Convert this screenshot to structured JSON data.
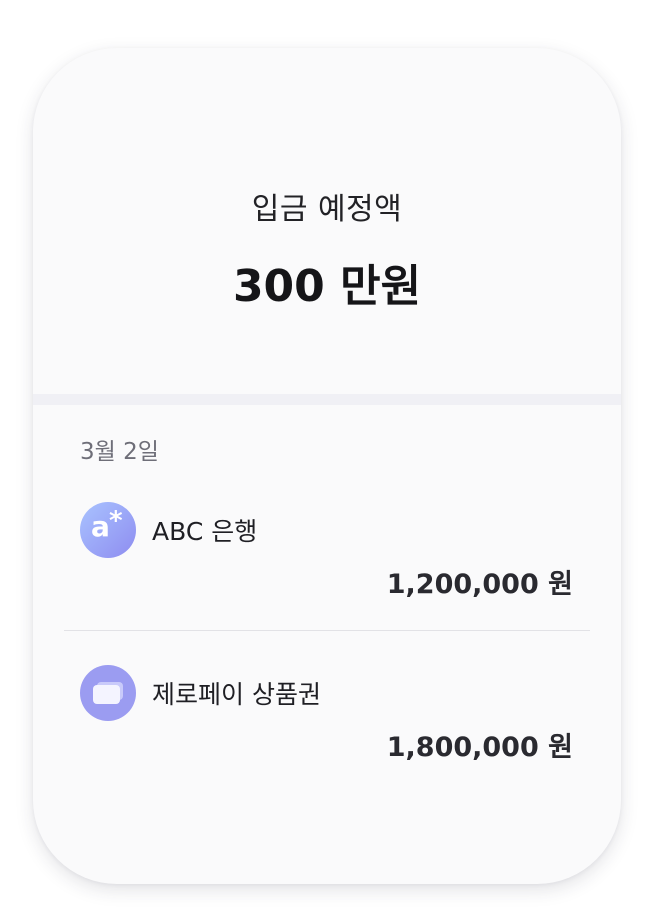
{
  "summary": {
    "label": "입금 예정액",
    "amount": "300 만원"
  },
  "deposits": {
    "date": "3월 2일",
    "items": [
      {
        "name": "ABC 은행",
        "amount": "1,200,000 원",
        "icon": "bank-logo-icon",
        "icon_glyph": "a*"
      },
      {
        "name": "제로페이 상품권",
        "amount": "1,800,000 원",
        "icon": "gift-card-icon"
      }
    ]
  },
  "colors": {
    "card_background": "#fafafb",
    "divider": "#f0f0f5",
    "icon_purple": "#9b9cf1",
    "icon_gradient_start": "#a9c3ff",
    "icon_gradient_end": "#8e8cf0",
    "text_primary": "#151518",
    "text_secondary": "#6e6e78"
  }
}
